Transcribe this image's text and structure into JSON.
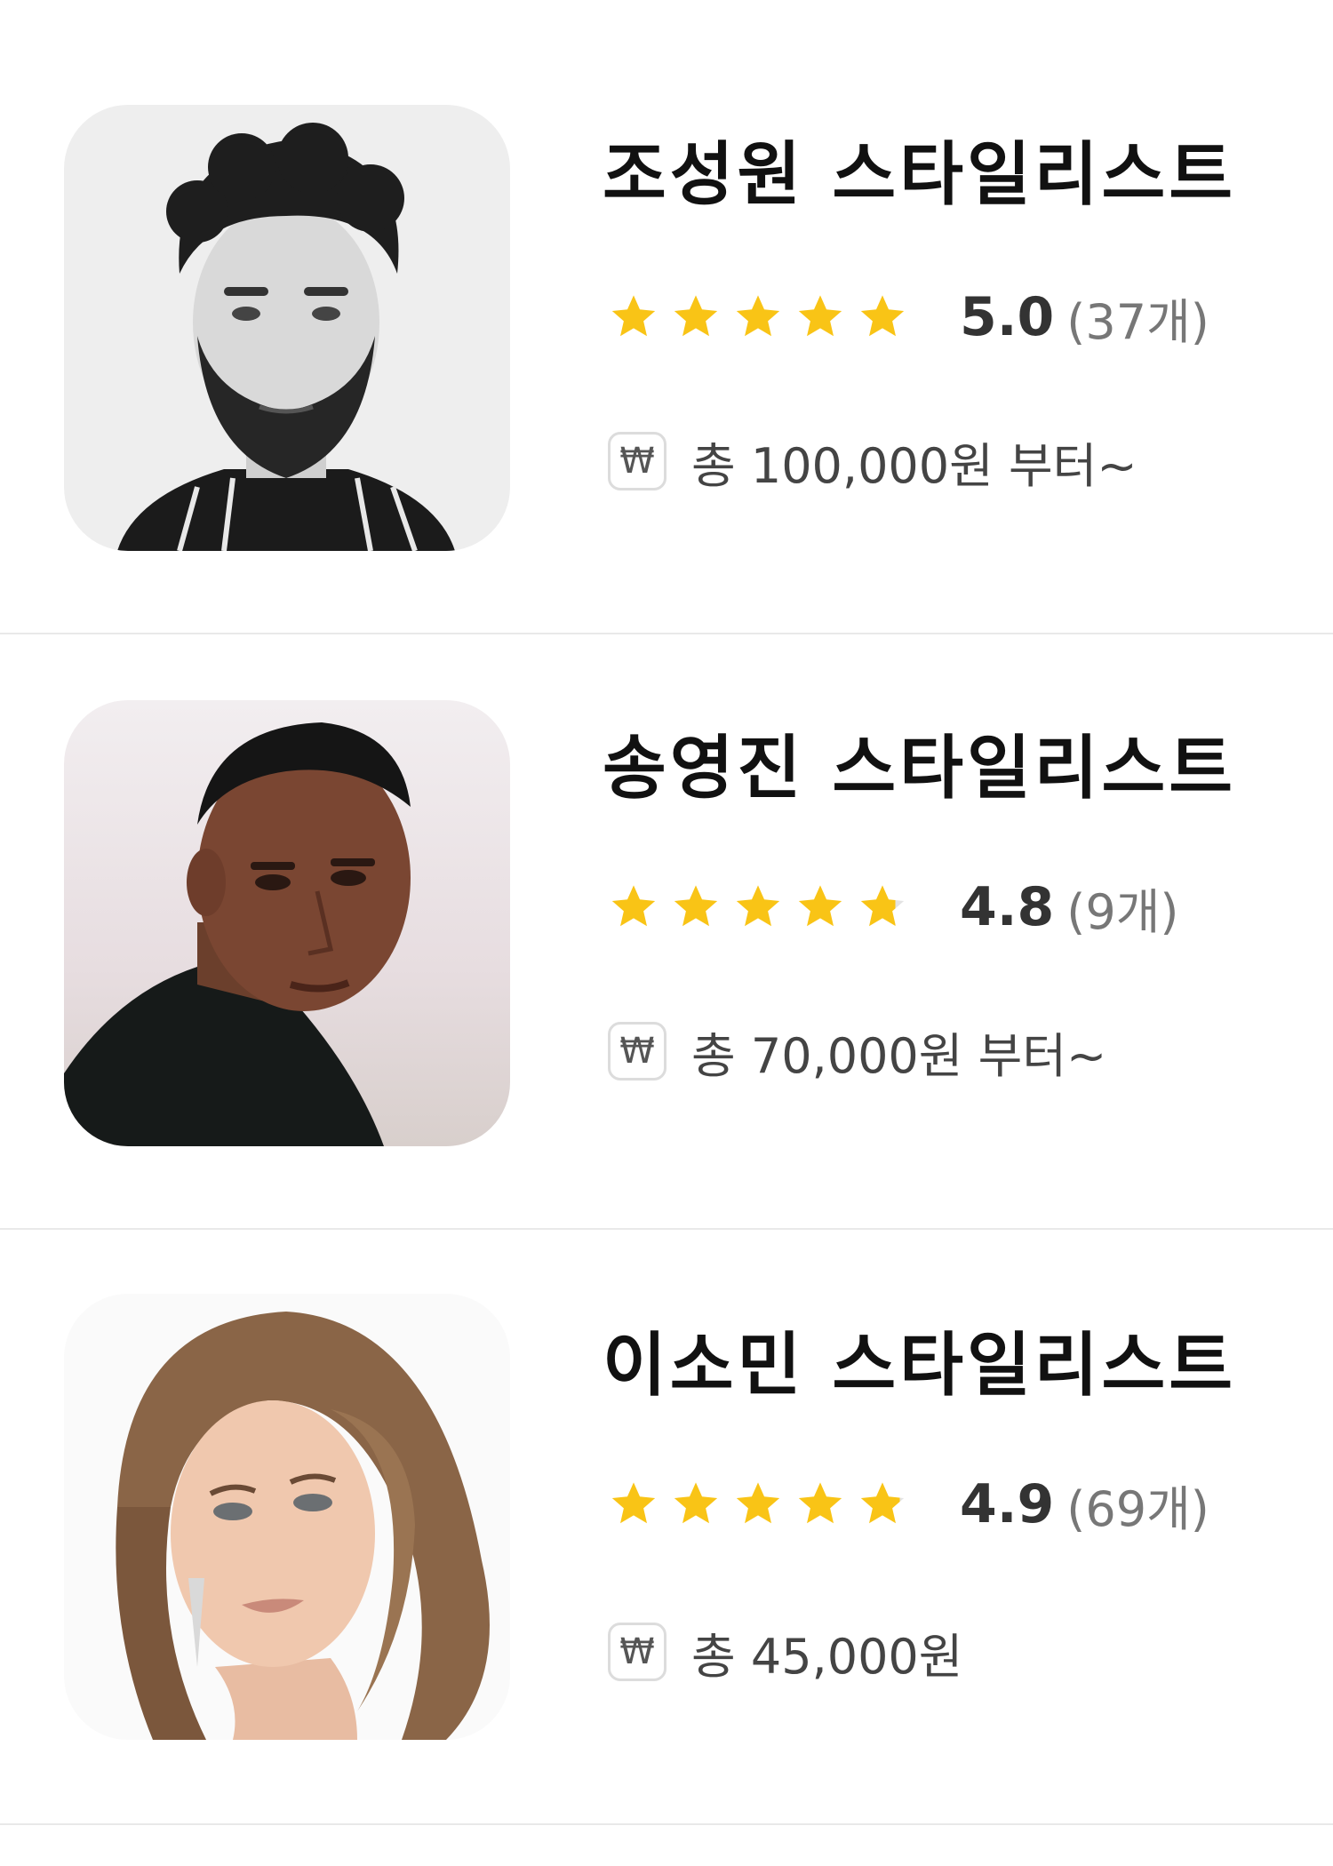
{
  "stylists": [
    {
      "name": "조성원 스타일리스트",
      "rating": 5.0,
      "rating_text": "5.0",
      "review_count": "(37개)",
      "price_text": "총 100,000원 부터~",
      "photo_style": "black-and-white portrait, curly hair, beard"
    },
    {
      "name": "송영진 스타일리스트",
      "rating": 4.8,
      "rating_text": "4.8",
      "review_count": "(9개)",
      "price_text": "총 70,000원 부터~",
      "photo_style": "color portrait, short fade haircut, black turtleneck"
    },
    {
      "name": "이소민 스타일리스트",
      "rating": 4.9,
      "rating_text": "4.9",
      "review_count": "(69개)",
      "price_text": "총 45,000원",
      "photo_style": "color portrait, long light-brown hair"
    }
  ],
  "icons": {
    "star": "star-icon",
    "currency": "won-icon",
    "currency_glyph": "₩"
  },
  "colors": {
    "star_filled": "#F9C416",
    "star_empty": "#E3E3E3",
    "divider": "#E9E9E9",
    "name_text": "#111111"
  }
}
